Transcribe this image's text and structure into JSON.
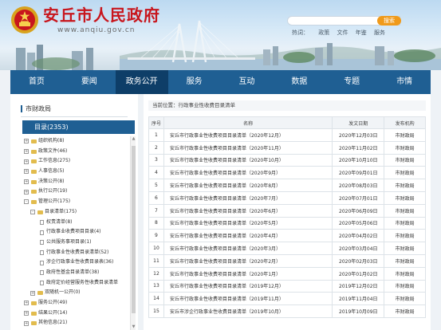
{
  "site": {
    "title": "安丘市人民政府",
    "url": "www.anqiu.gov.cn"
  },
  "search": {
    "placeholder": "",
    "button_label": "搜索"
  },
  "hot": {
    "label": "热词：",
    "items": [
      "政策",
      "文件",
      "年鉴",
      "服务"
    ]
  },
  "nav": {
    "items": [
      "首页",
      "要闻",
      "政务公开",
      "服务",
      "互动",
      "数据",
      "专题",
      "市情"
    ],
    "active_index": 2
  },
  "sidebar": {
    "heading": "市财政局",
    "catalog_label": "目录(2353)",
    "tree": [
      {
        "label": "组织机构(8)",
        "level": 1,
        "type": "folder",
        "toggle": "+"
      },
      {
        "label": "政策文件(46)",
        "level": 1,
        "type": "folder",
        "toggle": "+"
      },
      {
        "label": "工作信息(275)",
        "level": 1,
        "type": "folder",
        "toggle": "+"
      },
      {
        "label": "人事信息(5)",
        "level": 1,
        "type": "folder",
        "toggle": "+"
      },
      {
        "label": "决策公开(8)",
        "level": 1,
        "type": "folder",
        "toggle": "+"
      },
      {
        "label": "执行公开(19)",
        "level": 1,
        "type": "folder",
        "toggle": "+"
      },
      {
        "label": "管理公开(175)",
        "level": 1,
        "type": "folder",
        "toggle": "-"
      },
      {
        "label": "目录清单(175)",
        "level": 2,
        "type": "folder",
        "toggle": "-"
      },
      {
        "label": "权责清单(8)",
        "level": 3,
        "type": "doc"
      },
      {
        "label": "行政事业收费项目目录(4)",
        "level": 3,
        "type": "doc"
      },
      {
        "label": "公共服务事项目录(1)",
        "level": 3,
        "type": "doc"
      },
      {
        "label": "行政事业性收费目录清单(52)",
        "level": 3,
        "type": "doc"
      },
      {
        "label": "涉企行政事业性收费目录表(36)",
        "level": 3,
        "type": "doc"
      },
      {
        "label": "政府性基金目录清单(38)",
        "level": 3,
        "type": "doc"
      },
      {
        "label": "政府定价经营服务性收费目录清单",
        "level": 3,
        "type": "doc"
      },
      {
        "label": "双随机一公开(0)",
        "level": 2,
        "type": "folder",
        "toggle": "+"
      },
      {
        "label": "服务公开(49)",
        "level": 1,
        "type": "folder",
        "toggle": "+"
      },
      {
        "label": "结果公开(14)",
        "level": 1,
        "type": "folder",
        "toggle": "+"
      },
      {
        "label": "其他信息(21)",
        "level": 1,
        "type": "folder",
        "toggle": "+"
      }
    ]
  },
  "main": {
    "breadcrumb": "当前位置：行政事业性收费目录清单",
    "columns": [
      "序号",
      "名称",
      "发文日期",
      "发布机构"
    ],
    "rows": [
      [
        "1",
        "安丘市行政事业性收费项目目录清单（2020年12月）",
        "2020年12月03日",
        "市财政局"
      ],
      [
        "2",
        "安丘市行政事业性收费项目目录清单（2020年11月）",
        "2020年11月02日",
        "市财政局"
      ],
      [
        "3",
        "安丘市行政事业性收费项目目录清单（2020年10月）",
        "2020年10月10日",
        "市财政局"
      ],
      [
        "4",
        "安丘市行政事业性收费项目目录清单（2020年9月）",
        "2020年09月01日",
        "市财政局"
      ],
      [
        "5",
        "安丘市行政事业性收费项目目录清单（2020年8月）",
        "2020年08月03日",
        "市财政局"
      ],
      [
        "6",
        "安丘市行政事业性收费项目目录清单（2020年7月）",
        "2020年07月01日",
        "市财政局"
      ],
      [
        "7",
        "安丘市行政事业性收费项目目录清单（2020年6月）",
        "2020年06月09日",
        "市财政局"
      ],
      [
        "8",
        "安丘市行政事业性收费项目目录清单（2020年5月）",
        "2020年05月06日",
        "市财政局"
      ],
      [
        "9",
        "安丘市行政事业性收费项目目录清单（2020年4月）",
        "2020年04月02日",
        "市财政局"
      ],
      [
        "10",
        "安丘市行政事业性收费项目目录清单（2020年3月）",
        "2020年03月04日",
        "市财政局"
      ],
      [
        "11",
        "安丘市行政事业性收费项目目录清单（2020年2月）",
        "2020年02月03日",
        "市财政局"
      ],
      [
        "12",
        "安丘市行政事业性收费项目目录清单（2020年1月）",
        "2020年01月02日",
        "市财政局"
      ],
      [
        "13",
        "安丘市行政事业性收费项目目录清单（2019年12月）",
        "2019年12月02日",
        "市财政局"
      ],
      [
        "14",
        "安丘市行政事业性收费项目目录清单（2019年11月）",
        "2019年11月04日",
        "市财政局"
      ],
      [
        "15",
        "安丘市涉企行政事业性收费目录清单（2019年10月）",
        "2019年10月09日",
        "市财政局"
      ]
    ]
  },
  "colors": {
    "brand_red": "#c8161d",
    "nav_blue": "#1f5f93",
    "nav_active": "#0e3e68",
    "search_orange": "#f09a1a"
  }
}
